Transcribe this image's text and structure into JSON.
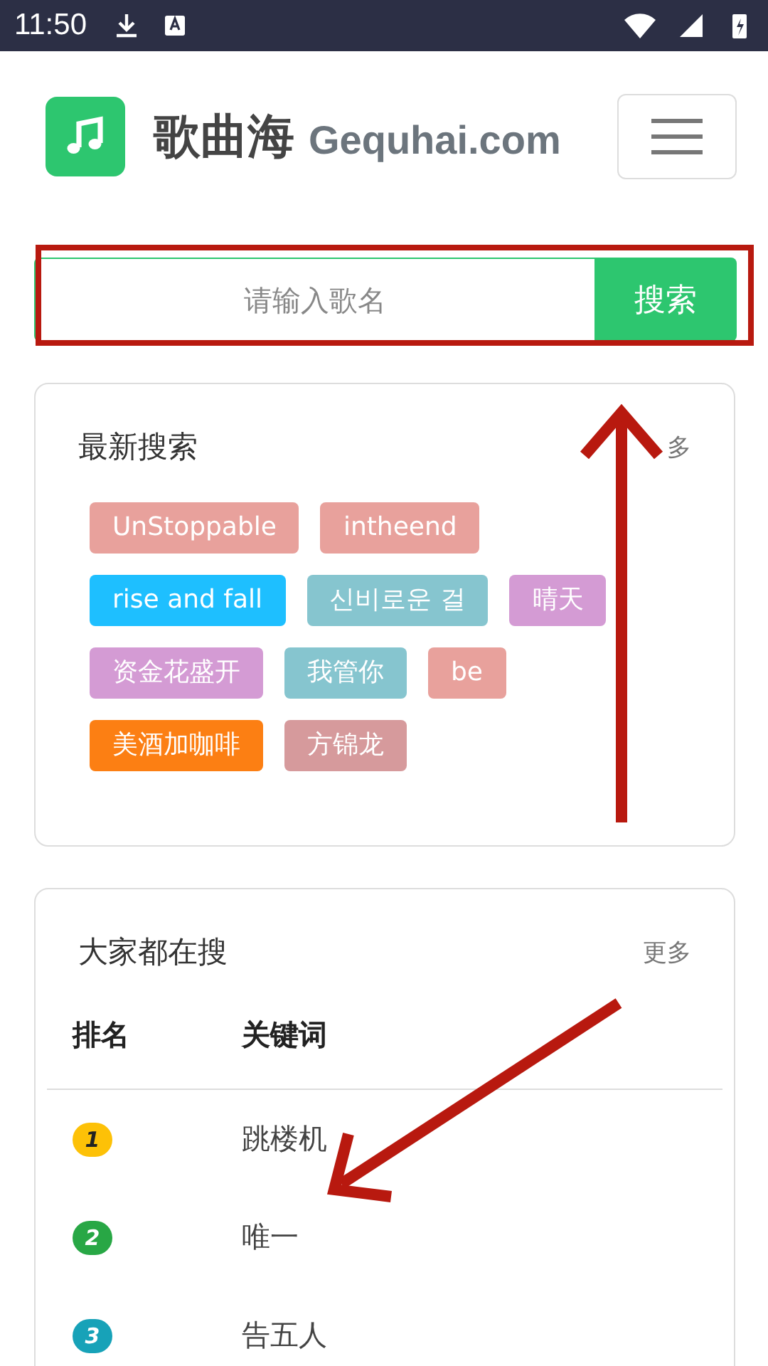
{
  "status_bar": {
    "time": "11:50"
  },
  "header": {
    "title": "歌曲海",
    "domain": "Gequhai.com"
  },
  "search": {
    "placeholder": "请输入歌名",
    "button": "搜索"
  },
  "recent": {
    "title": "最新搜索",
    "more": "多",
    "tags": [
      {
        "label": "UnStoppable",
        "color": "#e8a19c"
      },
      {
        "label": "intheend",
        "color": "#e8a19c"
      },
      {
        "label": "rise and fall",
        "color": "#1ebfff"
      },
      {
        "label": "신비로운 걸",
        "color": "#86c5cf"
      },
      {
        "label": "晴天",
        "color": "#d49bd4"
      },
      {
        "label": "资金花盛开",
        "color": "#d49bd4"
      },
      {
        "label": "我管你",
        "color": "#86c5cf"
      },
      {
        "label": "be",
        "color": "#e8a19c"
      },
      {
        "label": "美酒加咖啡",
        "color": "#fc7f13"
      },
      {
        "label": "方锦龙",
        "color": "#d69a9c"
      }
    ]
  },
  "popular": {
    "title": "大家都在搜",
    "more": "更多",
    "columns": [
      "排名",
      "关键词"
    ],
    "rows": [
      {
        "rank": "1",
        "keyword": "跳楼机",
        "color": "#fdc107"
      },
      {
        "rank": "2",
        "keyword": "唯一",
        "color": "#28a745"
      },
      {
        "rank": "3",
        "keyword": "告五人",
        "color": "#17a2b8"
      }
    ]
  }
}
